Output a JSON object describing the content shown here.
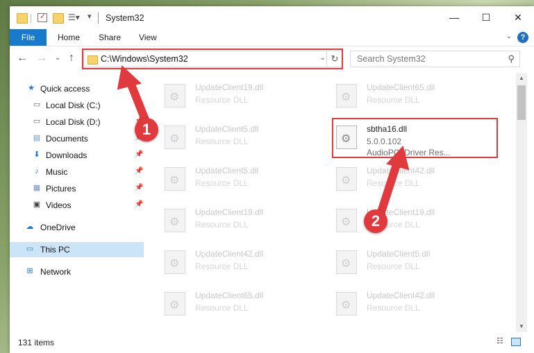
{
  "window": {
    "title": "System32",
    "controls": {
      "minimize": "—",
      "maximize": "☐",
      "close": "✕"
    }
  },
  "ribbon": {
    "tabs": [
      "File",
      "Home",
      "Share",
      "View"
    ],
    "help": "?"
  },
  "address": {
    "path": "C:\\Windows\\System32",
    "search_placeholder": "Search System32"
  },
  "sidebar": {
    "items": [
      {
        "label": "Quick access",
        "icon": "star-icon",
        "pinned": false
      },
      {
        "label": "Local Disk (C:)",
        "icon": "drive-icon",
        "pinned": true
      },
      {
        "label": "Local Disk (D:)",
        "icon": "drive-icon",
        "pinned": true
      },
      {
        "label": "Documents",
        "icon": "documents-icon",
        "pinned": true
      },
      {
        "label": "Downloads",
        "icon": "download-icon",
        "pinned": true
      },
      {
        "label": "Music",
        "icon": "music-icon",
        "pinned": true
      },
      {
        "label": "Pictures",
        "icon": "pictures-icon",
        "pinned": true
      },
      {
        "label": "Videos",
        "icon": "videos-icon",
        "pinned": true
      },
      {
        "label": "OneDrive",
        "icon": "cloud-icon",
        "pinned": false
      },
      {
        "label": "This PC",
        "icon": "computer-icon",
        "pinned": false,
        "selected": true
      },
      {
        "label": "Network",
        "icon": "network-icon",
        "pinned": false
      }
    ]
  },
  "files": {
    "left_column": [
      {
        "name": "UpdateClient19.dll",
        "type": "Resource DLL"
      },
      {
        "name": "UpdateClient5.dll",
        "type": "Resource DLL"
      },
      {
        "name": "UpdateClient5.dll",
        "type": "Resource DLL"
      },
      {
        "name": "UpdateClient19.dll",
        "type": "Resource DLL"
      },
      {
        "name": "UpdateClient42.dll",
        "type": "Resource DLL"
      },
      {
        "name": "UpdateClient65.dll",
        "type": "Resource DLL"
      }
    ],
    "right_column": [
      {
        "name": "UpdateClient65.dll",
        "type": "Resource DLL"
      },
      {
        "name": "sbtha16.dll",
        "version": "5.0.0.102",
        "type": "AudioPCI Driver Res...",
        "highlighted": true
      },
      {
        "name": "UpdateClient42.dll",
        "type": "Resource DLL"
      },
      {
        "name": "UpdateClient19.dll",
        "type": "Resource DLL"
      },
      {
        "name": "UpdateClient5.dll",
        "type": "Resource DLL"
      },
      {
        "name": "UpdateClient42.dll",
        "type": "Resource DLL"
      }
    ]
  },
  "status": {
    "item_count": "131 items"
  },
  "annotations": {
    "step1": "1",
    "step2": "2",
    "color": "#e0393e"
  }
}
